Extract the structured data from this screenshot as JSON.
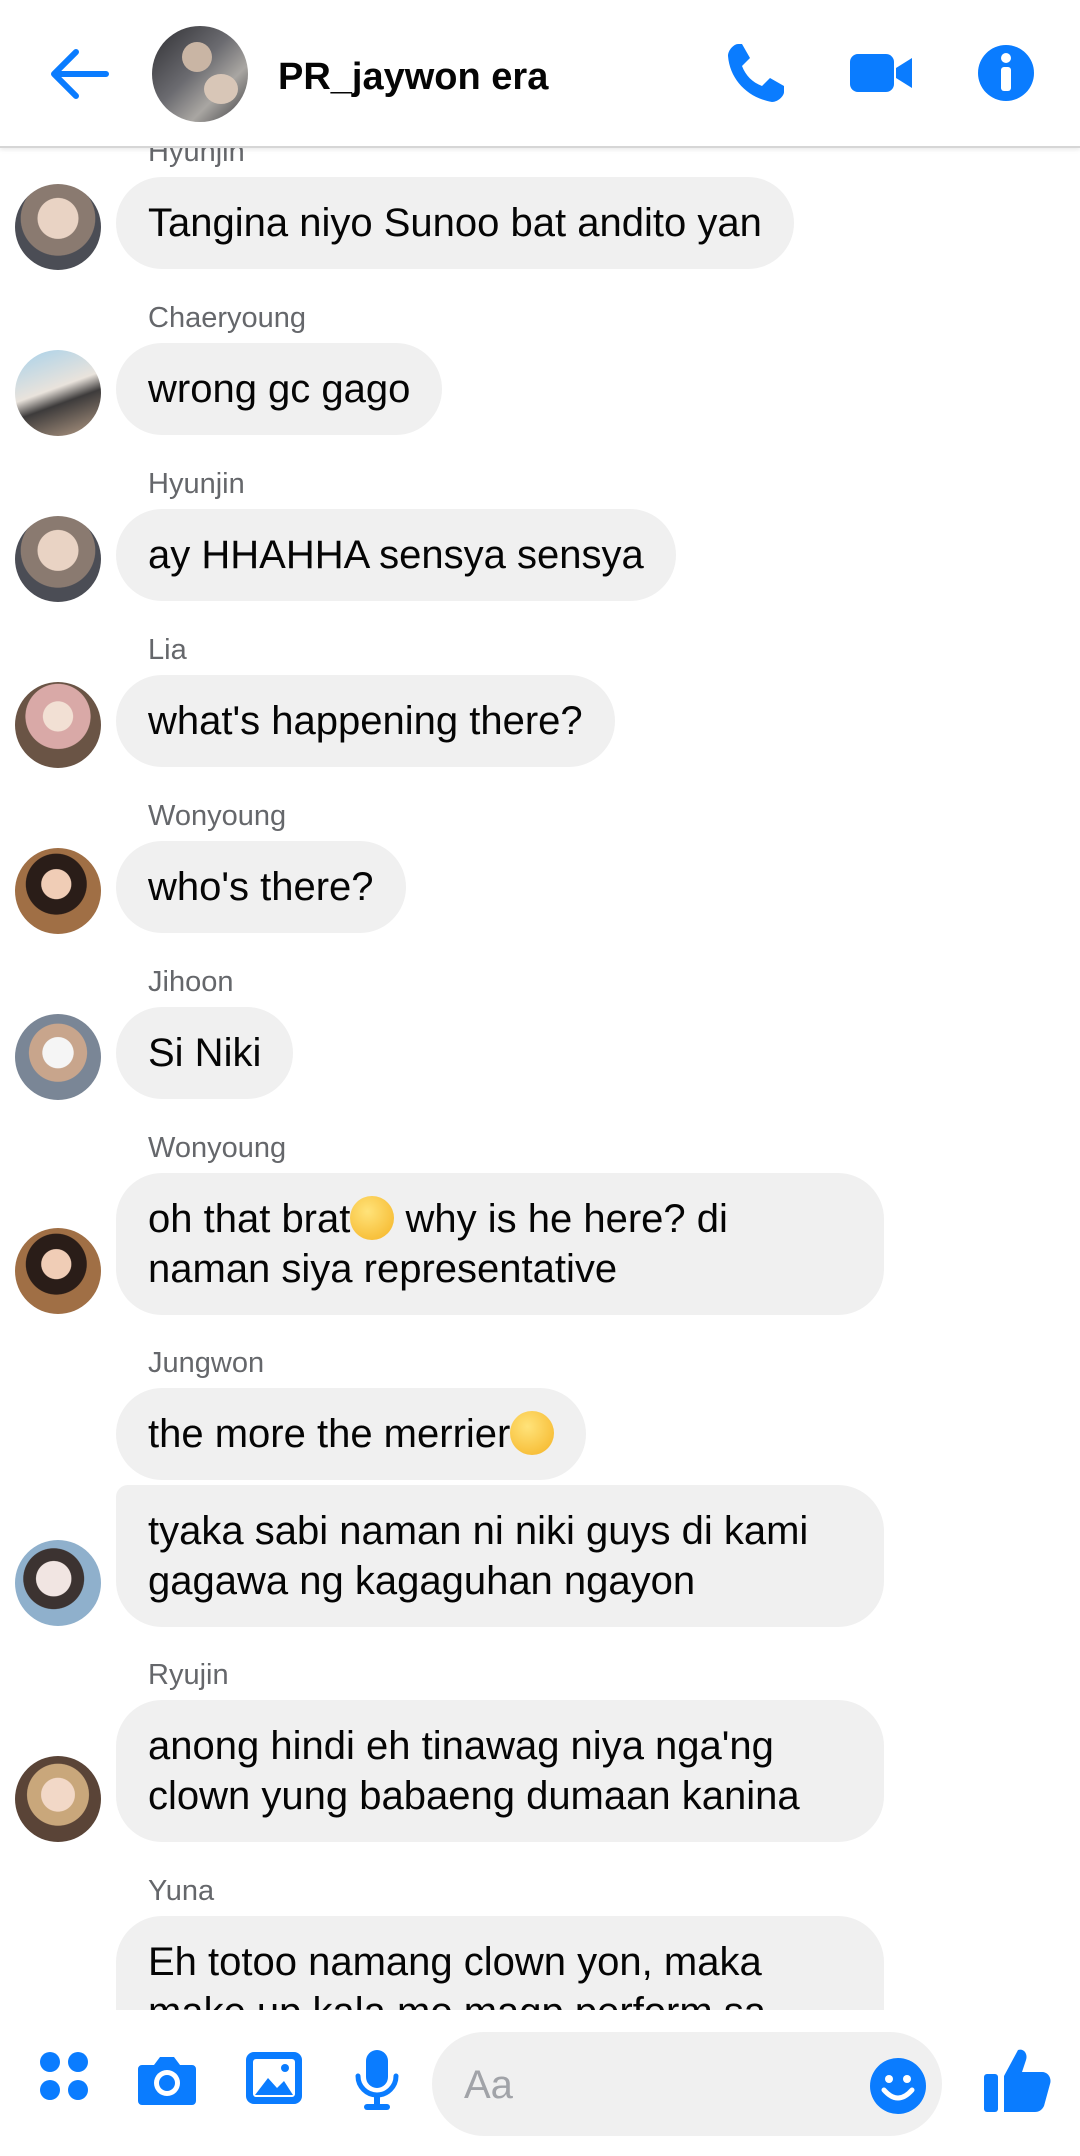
{
  "header": {
    "title": "PR_jaywon era",
    "icons": [
      "back-arrow-icon",
      "phone-icon",
      "video-camera-icon",
      "info-icon"
    ],
    "accent_color": "#0a7cff"
  },
  "messages": [
    {
      "sender": "Hyunjin",
      "text": "Tangina niyo Sunoo bat andito yan"
    },
    {
      "sender": "Chaeryoung",
      "text": "wrong gc gago"
    },
    {
      "sender": "Hyunjin",
      "text": "ay HHAHHA sensya sensya"
    },
    {
      "sender": "Lia",
      "text": "what's happening there?"
    },
    {
      "sender": "Wonyoung",
      "text": "who's there?"
    },
    {
      "sender": "Jihoon",
      "text": "Si Niki"
    },
    {
      "sender": "Wonyoung",
      "text_before_emoji": "oh that brat",
      "emoji": "face-with-rolling-eyes",
      "text_after_emoji": " why is he here? di\nnaman siya representative"
    },
    {
      "sender": "Jungwon",
      "text_before_emoji": "the more the merrier",
      "emoji": "relieved-face"
    },
    {
      "text": "tyaka sabi naman ni niki guys di kami\ngagawa ng kagaguhan ngayon"
    },
    {
      "sender": "Ryujin",
      "text": "anong hindi eh tinawag niya nga'ng\nclown yung babaeng dumaan kanina"
    },
    {
      "sender": "Yuna",
      "text": "Eh totoo namang clown yon, maka\nmake up kala mo magp perform sa"
    }
  ],
  "composer": {
    "placeholder": "Aa",
    "icons": [
      "apps-grid-icon",
      "camera-icon",
      "gallery-icon",
      "microphone-icon",
      "emoji-smile-icon",
      "thumbs-up-icon"
    ]
  }
}
